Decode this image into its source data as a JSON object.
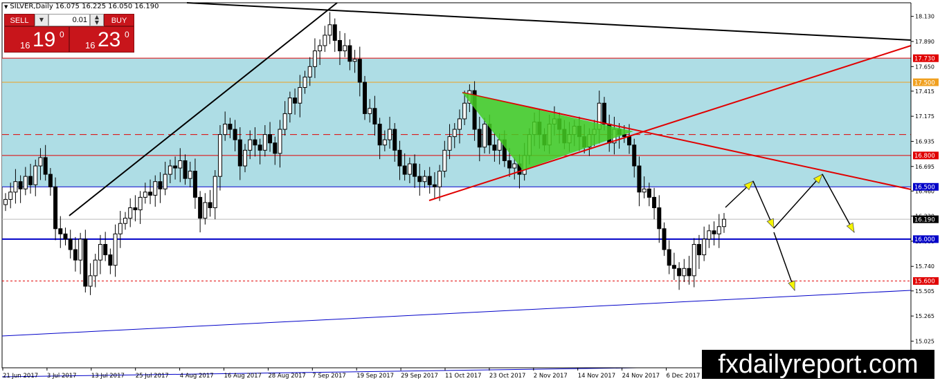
{
  "header": {
    "symbol_line": "SILVER,Daily  16.075 16.225 16.050 16.190"
  },
  "trade_panel": {
    "sell_label": "SELL",
    "buy_label": "BUY",
    "lot_value": "0.01",
    "sell_big": "19",
    "sell_small": "16",
    "sell_sup": "0",
    "buy_big": "23",
    "buy_small": "16",
    "buy_sup": "0"
  },
  "watermark": "fxdailyreport.com",
  "colors": {
    "zone": "#aedde5",
    "bear": "#000000",
    "bull": "#ffffff",
    "red_line": "#e00000",
    "blue_line": "#0000c8",
    "pattern": "#44cc22",
    "arrow_fill": "#f5f500"
  },
  "chart_data": {
    "type": "candlestick",
    "symbol": "SILVER",
    "timeframe": "Daily",
    "price_axis_ticks": [
      "18.130",
      "17.890",
      "17.650",
      "17.415",
      "17.175",
      "16.935",
      "16.695",
      "16.460",
      "16.220",
      "15.980",
      "15.740",
      "15.505",
      "15.265",
      "15.025"
    ],
    "price_range": [
      14.77,
      18.26
    ],
    "date_labels": [
      "21 Jun 2017",
      "3 Jul 2017",
      "13 Jul 2017",
      "25 Jul 2017",
      "4 Aug 2017",
      "16 Aug 2017",
      "28 Aug 2017",
      "7 Sep 2017",
      "19 Sep 2017",
      "29 Sep 2017",
      "11 Oct 2017",
      "23 Oct 2017",
      "2 Nov 2017",
      "14 Nov 2017",
      "24 Nov 2017",
      "6 Dec 2017"
    ],
    "level_labels": [
      {
        "price": 17.73,
        "text": "17.730",
        "color": "#e00000"
      },
      {
        "price": 17.5,
        "text": "17.500",
        "color": "#f0a020"
      },
      {
        "price": 16.8,
        "text": "16.800",
        "color": "#e00000"
      },
      {
        "price": 16.5,
        "text": "16.500",
        "color": "#0000c8"
      },
      {
        "price": 16.19,
        "text": "16.190",
        "color": "#000000"
      },
      {
        "price": 16.0,
        "text": "16.000",
        "color": "#0000c8"
      },
      {
        "price": 15.6,
        "text": "15.600",
        "color": "#e00000"
      }
    ],
    "supply_zone": [
      16.5,
      17.73
    ],
    "dashed_level": 17.0,
    "closes": [
      16.38,
      16.45,
      16.55,
      16.48,
      16.6,
      16.52,
      16.7,
      16.78,
      16.62,
      16.5,
      16.1,
      16.05,
      16.0,
      15.9,
      15.8,
      16.0,
      15.55,
      15.65,
      15.8,
      15.95,
      15.85,
      15.75,
      16.05,
      16.15,
      16.2,
      16.3,
      16.28,
      16.4,
      16.45,
      16.42,
      16.55,
      16.48,
      16.62,
      16.7,
      16.68,
      16.75,
      16.58,
      16.65,
      16.4,
      16.2,
      16.35,
      16.3,
      16.6,
      17.0,
      17.1,
      17.05,
      16.95,
      16.7,
      16.85,
      16.95,
      16.9,
      16.85,
      17.0,
      16.92,
      16.82,
      17.05,
      17.2,
      17.35,
      17.3,
      17.45,
      17.55,
      17.65,
      17.8,
      17.85,
      17.95,
      18.05,
      17.9,
      17.8,
      17.85,
      17.7,
      17.72,
      17.5,
      17.2,
      17.25,
      17.1,
      16.9,
      16.95,
      17.05,
      16.85,
      16.7,
      16.62,
      16.72,
      16.6,
      16.55,
      16.6,
      16.52,
      16.5,
      16.65,
      16.85,
      16.98,
      17.05,
      17.15,
      17.3,
      17.42,
      17.05,
      16.88,
      17.1,
      16.9,
      16.85,
      16.95,
      16.75,
      16.68,
      16.72,
      16.62,
      16.8,
      17.0,
      17.12,
      17.0,
      16.9,
      17.1,
      17.15,
      17.05,
      16.92,
      17.0,
      17.08,
      16.98,
      16.88,
      17.0,
      17.05,
      17.3,
      17.1,
      16.92,
      17.05,
      17.0,
      16.98,
      16.9,
      16.7,
      16.45,
      16.48,
      16.4,
      16.3,
      16.1,
      15.9,
      15.75,
      15.72,
      15.65,
      15.72,
      15.65,
      15.95,
      15.85,
      16.0,
      16.08,
      16.05,
      16.12,
      16.19
    ],
    "annotations": {
      "pattern": "symmetrical triangle (green)",
      "projection_arrows": "yellow zig-zag forecast path"
    }
  }
}
